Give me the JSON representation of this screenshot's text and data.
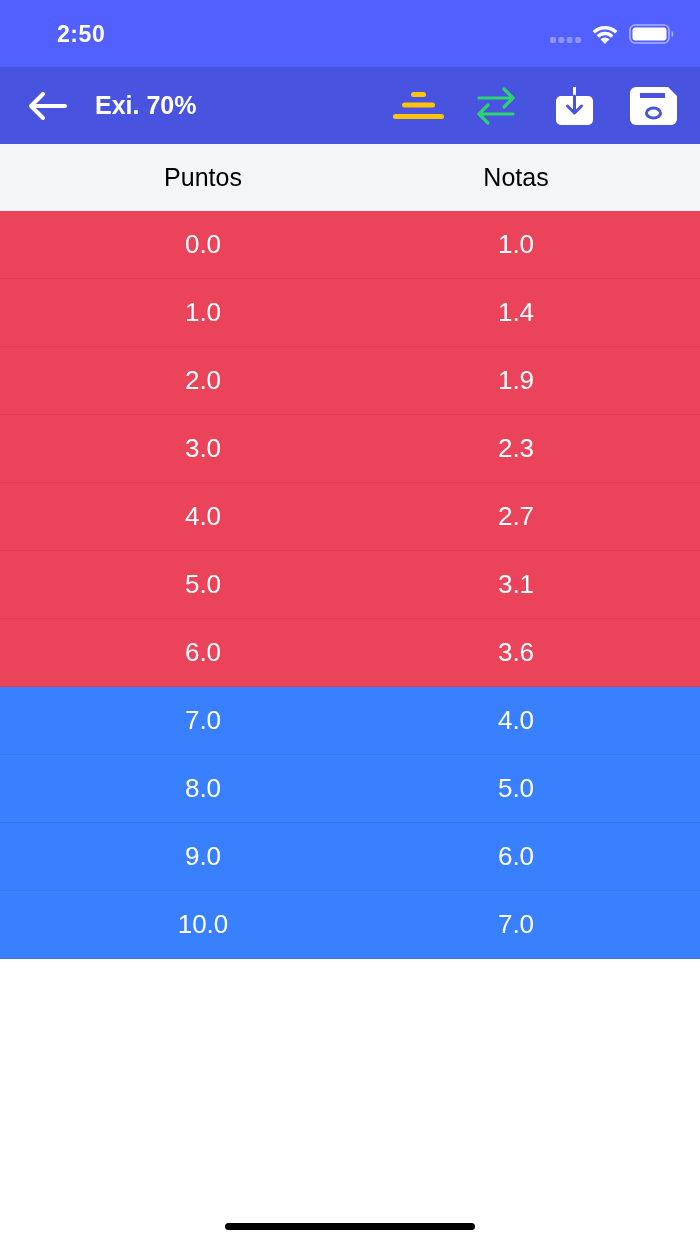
{
  "status_bar": {
    "time": "2:50"
  },
  "header": {
    "title": "Exi. 70%"
  },
  "table": {
    "columns": [
      "Puntos",
      "Notas"
    ],
    "rows": [
      {
        "cells": [
          "0.0",
          "1.0"
        ],
        "color": "#eb445a"
      },
      {
        "cells": [
          "1.0",
          "1.4"
        ],
        "color": "#eb445a"
      },
      {
        "cells": [
          "2.0",
          "1.9"
        ],
        "color": "#eb445a"
      },
      {
        "cells": [
          "3.0",
          "2.3"
        ],
        "color": "#eb445a"
      },
      {
        "cells": [
          "4.0",
          "2.7"
        ],
        "color": "#eb445a"
      },
      {
        "cells": [
          "5.0",
          "3.1"
        ],
        "color": "#eb445a"
      },
      {
        "cells": [
          "6.0",
          "3.6"
        ],
        "color": "#eb445a"
      },
      {
        "cells": [
          "7.0",
          "4.0"
        ],
        "color": "#3880ff"
      },
      {
        "cells": [
          "8.0",
          "5.0"
        ],
        "color": "#3880ff"
      },
      {
        "cells": [
          "9.0",
          "6.0"
        ],
        "color": "#3880ff"
      },
      {
        "cells": [
          "10.0",
          "7.0"
        ],
        "color": "#3880ff"
      }
    ]
  }
}
